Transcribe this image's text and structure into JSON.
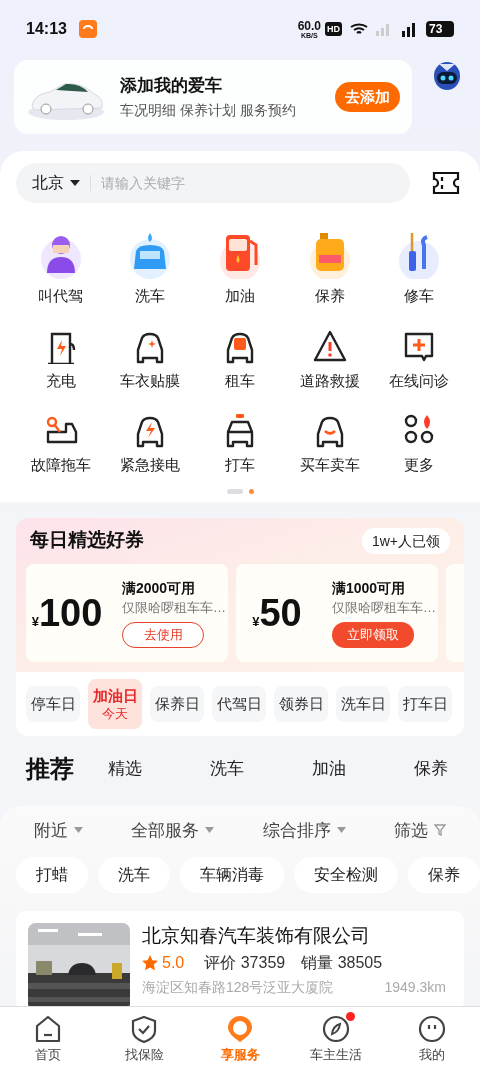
{
  "status_bar": {
    "time": "14:13",
    "speed": "60.0",
    "speed_unit": "KB/S",
    "hd": "HD",
    "battery": "73"
  },
  "car_card": {
    "title": "添加我的爱车",
    "subtitle": "车况明细 保养计划 服务预约",
    "button": "去添加"
  },
  "search": {
    "city": "北京",
    "placeholder": "请输入关键字"
  },
  "services": [
    {
      "label": "叫代驾"
    },
    {
      "label": "洗车"
    },
    {
      "label": "加油"
    },
    {
      "label": "保养"
    },
    {
      "label": "修车"
    },
    {
      "label": "充电"
    },
    {
      "label": "车衣贴膜"
    },
    {
      "label": "租车"
    },
    {
      "label": "道路救援"
    },
    {
      "label": "在线问诊"
    },
    {
      "label": "故障拖车"
    },
    {
      "label": "紧急接电"
    },
    {
      "label": "打车"
    },
    {
      "label": "买车卖车"
    },
    {
      "label": "更多"
    }
  ],
  "pager": [
    {
      "selected": false
    },
    {
      "selected": true
    }
  ],
  "coupons": {
    "title": "每日精选好券",
    "claimed_count": "1w+人已领",
    "items": [
      {
        "currency": "¥",
        "amount": "100",
        "condition": "满2000可用",
        "note": "仅限哈啰租车车…",
        "button": "去使用",
        "claimed": true
      },
      {
        "currency": "¥",
        "amount": "50",
        "condition": "满1000可用",
        "note": "仅限哈啰租车车…",
        "button": "立即领取",
        "claimed": false
      }
    ],
    "days": [
      {
        "label": "停车日",
        "selected": false
      },
      {
        "label": "加油日",
        "sub": "今天",
        "selected": true
      },
      {
        "label": "保养日",
        "selected": false
      },
      {
        "label": "代驾日",
        "selected": false
      },
      {
        "label": "领券日",
        "selected": false
      },
      {
        "label": "洗车日",
        "selected": false
      },
      {
        "label": "打车日",
        "selected": false
      }
    ]
  },
  "recommend": {
    "title": "推荐",
    "tabs": [
      {
        "label": "精选",
        "selected": false
      },
      {
        "label": "洗车",
        "selected": false
      },
      {
        "label": "加油",
        "selected": false
      },
      {
        "label": "保养",
        "selected": false
      }
    ]
  },
  "filters": [
    {
      "label": "附近",
      "kind": "dropdown"
    },
    {
      "label": "全部服务",
      "kind": "dropdown"
    },
    {
      "label": "综合排序",
      "kind": "dropdown"
    },
    {
      "label": "筛选",
      "kind": "filter"
    }
  ],
  "chips": [
    "打蜡",
    "洗车",
    "车辆消毒",
    "安全检测",
    "保养"
  ],
  "shop": {
    "kind": "picture",
    "name": "北京知春汽车装饰有限公司",
    "rating": "5.0",
    "reviews": "评价 37359",
    "sales": "销量 38505",
    "address": "海淀区知春路128号泛亚大厦院",
    "distance": "1949.3km"
  },
  "nav": [
    {
      "label": "首页",
      "selected": false,
      "badge": false
    },
    {
      "label": "找保险",
      "selected": false,
      "badge": false
    },
    {
      "label": "享服务",
      "selected": true,
      "badge": false
    },
    {
      "label": "车主生活",
      "selected": false,
      "badge": true
    },
    {
      "label": "我的",
      "selected": false,
      "badge": false
    }
  ]
}
